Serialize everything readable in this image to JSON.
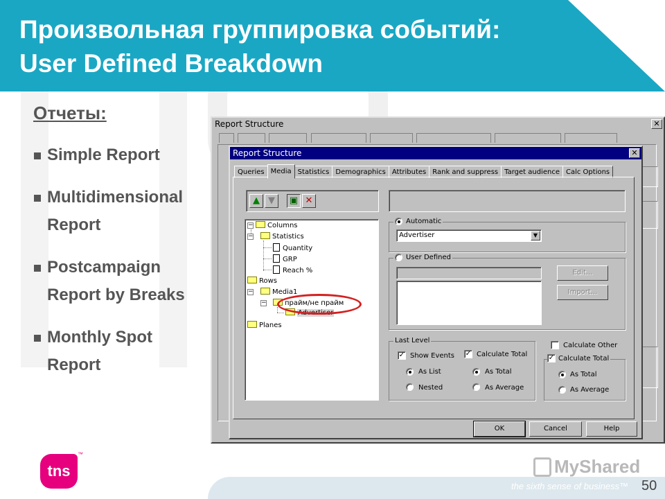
{
  "slide": {
    "title_line1": "Произвольная группировка событий:",
    "title_line2": "User Defined Breakdown",
    "reports_heading": "Отчеты:",
    "bullets": [
      {
        "line1": "Simple Report",
        "line2": ""
      },
      {
        "line1": "Multidimensional",
        "line2": "Report"
      },
      {
        "line1": "Postcampaign",
        "line2": "Report by Breaks"
      },
      {
        "line1": "Monthly Spot",
        "line2": "Report"
      }
    ],
    "logo_text": "tns",
    "logo_tm": "™",
    "tagline": "the sixth sense of business™",
    "watermark": "MyShared",
    "page_number": "50",
    "colors": {
      "header": "#1aa7c4",
      "logo": "#e6007e",
      "annotation": "#d42020"
    }
  },
  "outer_dialog": {
    "title": "Report Structure",
    "close_icon": "close-icon"
  },
  "dialog": {
    "title": "Report Structure",
    "close_label": "✕",
    "tabs": [
      "Queries",
      "Media",
      "Statistics",
      "Demographics",
      "Attributes",
      "Rank and suppress",
      "Target audience",
      "Calc Options"
    ],
    "active_tab": "Media",
    "tree": {
      "columns": "Columns",
      "statistics": "Statistics",
      "quantity": "Quantity",
      "grp": "GRP",
      "reach": "Reach %",
      "rows": "Rows",
      "media1": "Media1",
      "prime": "прайм/не прайм",
      "advertiser": "Advertiser",
      "planes": "Planes"
    },
    "automatic": {
      "label": "Automatic",
      "selected": true,
      "combo_value": "Advertiser"
    },
    "user_defined": {
      "label": "User Defined",
      "selected": false,
      "edit_button": "Edit...",
      "import_button": "Import..."
    },
    "last_level": {
      "label": "Last Level",
      "show_events": "Show Events",
      "show_events_checked": true,
      "calculate_total": "Calculate Total",
      "calculate_total_checked": true,
      "as_list": "As List",
      "nested": "Nested",
      "as_total": "As Total",
      "as_average": "As Average",
      "as_list_selected": true,
      "as_total_selected": true
    },
    "calc_other": {
      "label": "Calculate Other",
      "checked": false
    },
    "calc_total_group": {
      "label": "Calculate Total",
      "checked": true,
      "as_total": "As Total",
      "as_average": "As Average",
      "as_total_selected": true
    },
    "buttons": {
      "ok": "OK",
      "cancel": "Cancel",
      "help": "Help"
    }
  }
}
